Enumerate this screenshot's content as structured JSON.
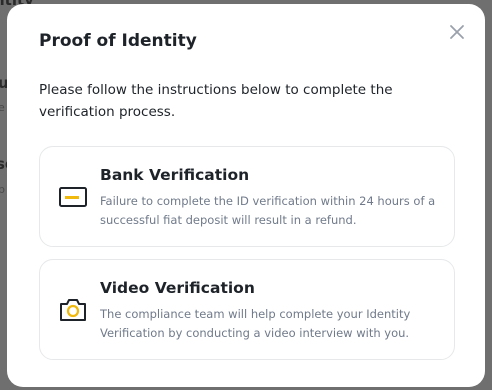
{
  "background": {
    "fragments": [
      "ntity",
      "u",
      "e",
      "se",
      "b"
    ]
  },
  "modal": {
    "title": "Proof of Identity",
    "close_icon": "close-icon",
    "intro": "Please follow the instructions below to complete the verification process.",
    "options": [
      {
        "title": "Bank Verification",
        "description": "Failure to complete the ID verification within 24 hours of a successful fiat deposit will result in a refund.",
        "icon": "bank-card-icon"
      },
      {
        "title": "Video Verification",
        "description": "The compliance team will help complete your Identity Verification by conducting a video interview with you.",
        "icon": "camera-icon"
      }
    ]
  },
  "colors": {
    "accent": "#f0b90b",
    "text_primary": "#1e2329",
    "text_secondary": "#707a8a",
    "overlay": "#6f6f6f"
  }
}
